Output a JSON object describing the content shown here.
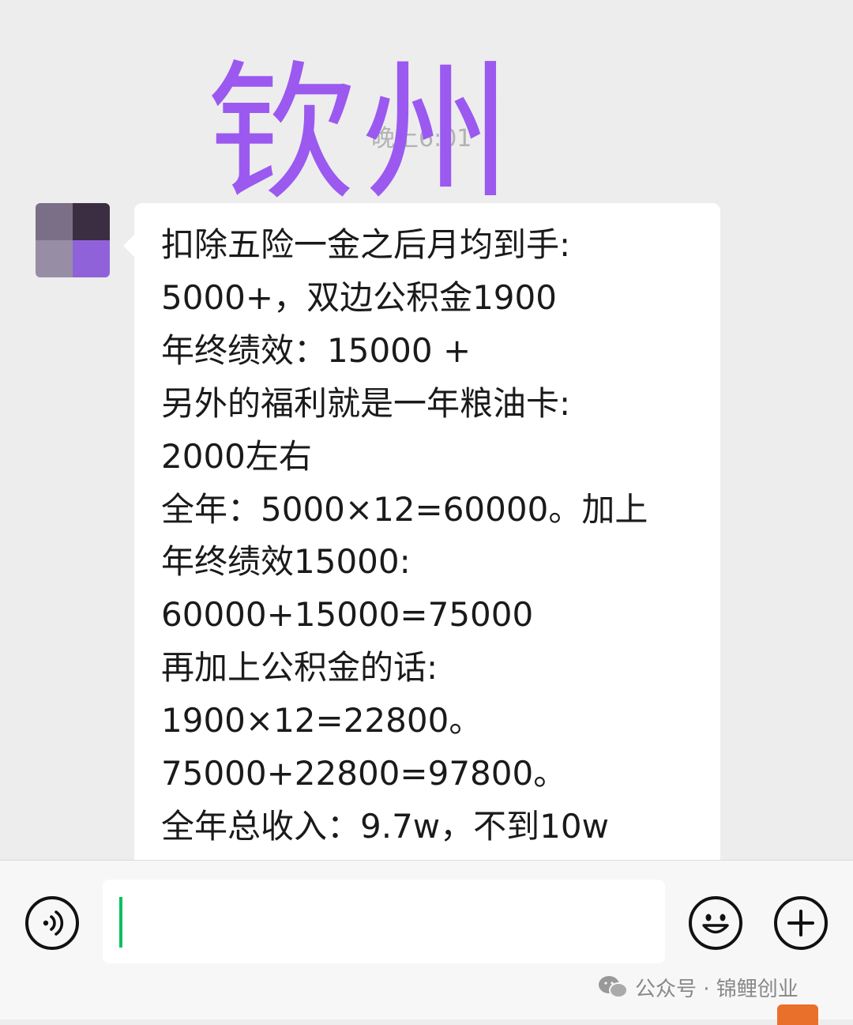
{
  "chat": {
    "timestamp": "晚上6:01",
    "overlay_title": "钦州",
    "message_lines": [
      "扣除五险一金之后月均到手:",
      "5000+，双边公积金1900",
      "年终绩效：15000 +",
      "另外的福利就是一年粮油卡:",
      "2000左右",
      "全年：5000×12=60000。加上",
      "年终绩效15000:",
      "60000+15000=75000",
      "再加上公积金的话:",
      "1900×12=22800。",
      "75000+22800=97800。",
      "全年总收入：9.7w，不到10w"
    ]
  },
  "input_bar": {
    "input_value": "",
    "voice_icon": "voice-icon",
    "emoji_icon": "emoji-icon",
    "plus_icon": "plus-icon"
  },
  "watermark": {
    "text": "公众号 · 锦鲤创业",
    "icon": "wechat-icon"
  },
  "colors": {
    "overlay_title": "#9b59f0",
    "cursor": "#07c160",
    "background": "#ededed",
    "bubble": "#ffffff"
  }
}
